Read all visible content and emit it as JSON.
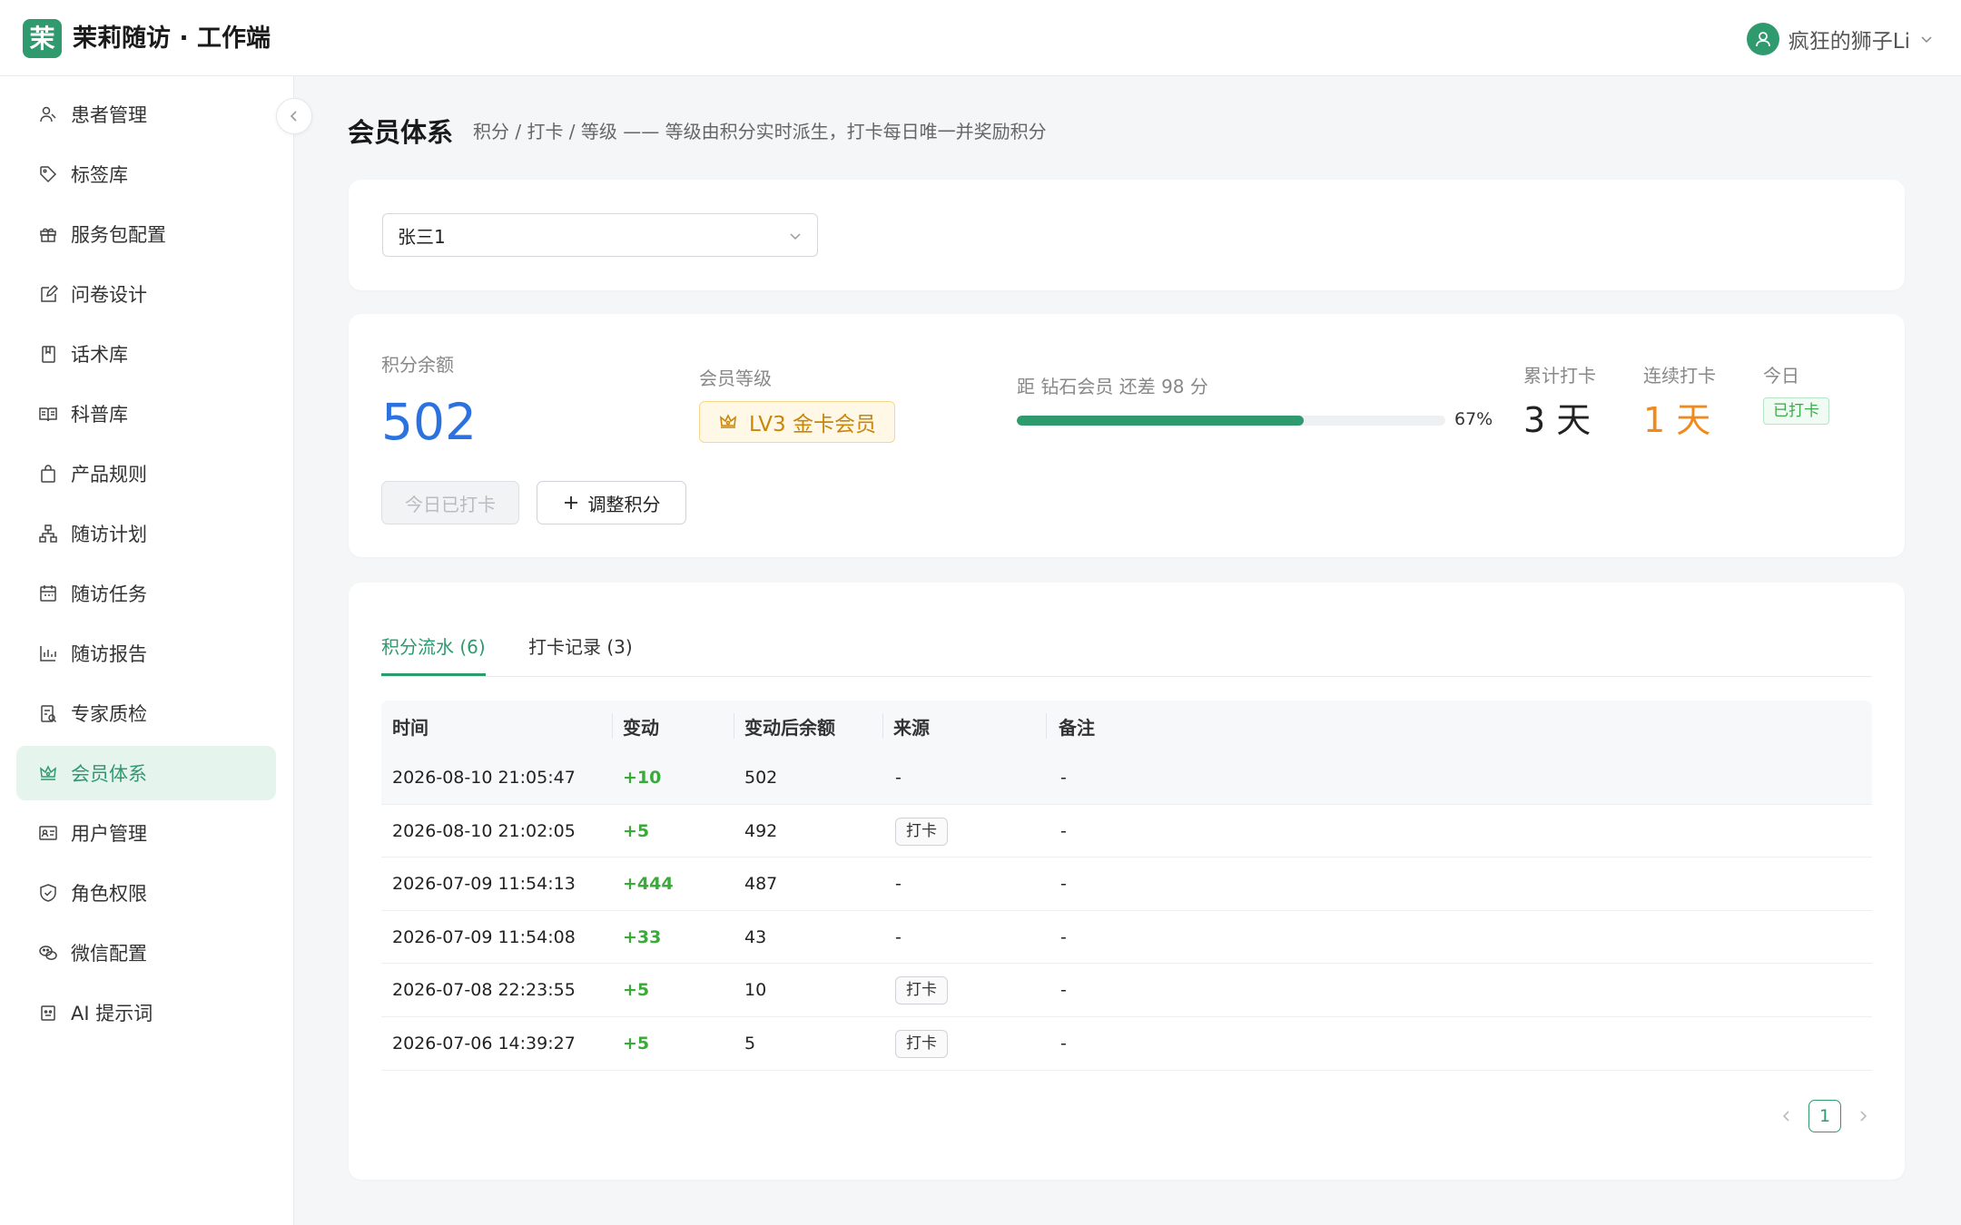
{
  "app": {
    "logo_char": "茉",
    "title": "茉莉随访 · 工作端",
    "brand_color": "#2e9a6e"
  },
  "user": {
    "name": "疯狂的狮子Li"
  },
  "sidebar": {
    "items": [
      {
        "label": "患者管理",
        "icon": "users-icon"
      },
      {
        "label": "标签库",
        "icon": "tag-icon"
      },
      {
        "label": "服务包配置",
        "icon": "gift-icon"
      },
      {
        "label": "问卷设计",
        "icon": "edit-icon"
      },
      {
        "label": "话术库",
        "icon": "book-icon"
      },
      {
        "label": "科普库",
        "icon": "open-book-icon"
      },
      {
        "label": "产品规则",
        "icon": "bag-icon"
      },
      {
        "label": "随访计划",
        "icon": "hierarchy-icon"
      },
      {
        "label": "随访任务",
        "icon": "calendar-icon"
      },
      {
        "label": "随访报告",
        "icon": "bar-chart-icon"
      },
      {
        "label": "专家质检",
        "icon": "audit-icon"
      },
      {
        "label": "会员体系",
        "icon": "crown-icon",
        "active": true
      },
      {
        "label": "用户管理",
        "icon": "id-card-icon"
      },
      {
        "label": "角色权限",
        "icon": "shield-icon"
      },
      {
        "label": "微信配置",
        "icon": "wechat-icon"
      },
      {
        "label": "AI 提示词",
        "icon": "robot-icon"
      }
    ]
  },
  "page": {
    "title": "会员体系",
    "subtitle": "积分 / 打卡 / 等级 —— 等级由积分实时派生，打卡每日唯一并奖励积分"
  },
  "patient_select": {
    "value": "张三1"
  },
  "stats": {
    "balance_label": "积分余额",
    "balance_value": "502",
    "level_label": "会员等级",
    "level_value": "LV3 金卡会员",
    "progress_label": "距 钻石会员 还差 98 分",
    "progress_percent": 67,
    "progress_text": "67%",
    "total_checkin_label": "累计打卡",
    "total_checkin_value": "3 天",
    "streak_label": "连续打卡",
    "streak_value": "1 天",
    "today_label": "今日",
    "today_badge": "已打卡",
    "checkin_button": "今日已打卡",
    "adjust_button": "调整积分"
  },
  "tabs": [
    {
      "label": "积分流水 (6)",
      "active": true
    },
    {
      "label": "打卡记录 (3)",
      "active": false
    }
  ],
  "table": {
    "columns": [
      "时间",
      "变动",
      "变动后余额",
      "来源",
      "备注"
    ],
    "rows": [
      {
        "time": "2026-08-10 21:05:47",
        "change": "+10",
        "balance": "502",
        "source": "-",
        "source_is_tag": false,
        "note": "-"
      },
      {
        "time": "2026-08-10 21:02:05",
        "change": "+5",
        "balance": "492",
        "source": "打卡",
        "source_is_tag": true,
        "note": "-"
      },
      {
        "time": "2026-07-09 11:54:13",
        "change": "+444",
        "balance": "487",
        "source": "-",
        "source_is_tag": false,
        "note": "-"
      },
      {
        "time": "2026-07-09 11:54:08",
        "change": "+33",
        "balance": "43",
        "source": "-",
        "source_is_tag": false,
        "note": "-"
      },
      {
        "time": "2026-07-08 22:23:55",
        "change": "+5",
        "balance": "10",
        "source": "打卡",
        "source_is_tag": true,
        "note": "-"
      },
      {
        "time": "2026-07-06 14:39:27",
        "change": "+5",
        "balance": "5",
        "source": "打卡",
        "source_is_tag": true,
        "note": "-"
      }
    ]
  },
  "pagination": {
    "current_page": "1"
  }
}
